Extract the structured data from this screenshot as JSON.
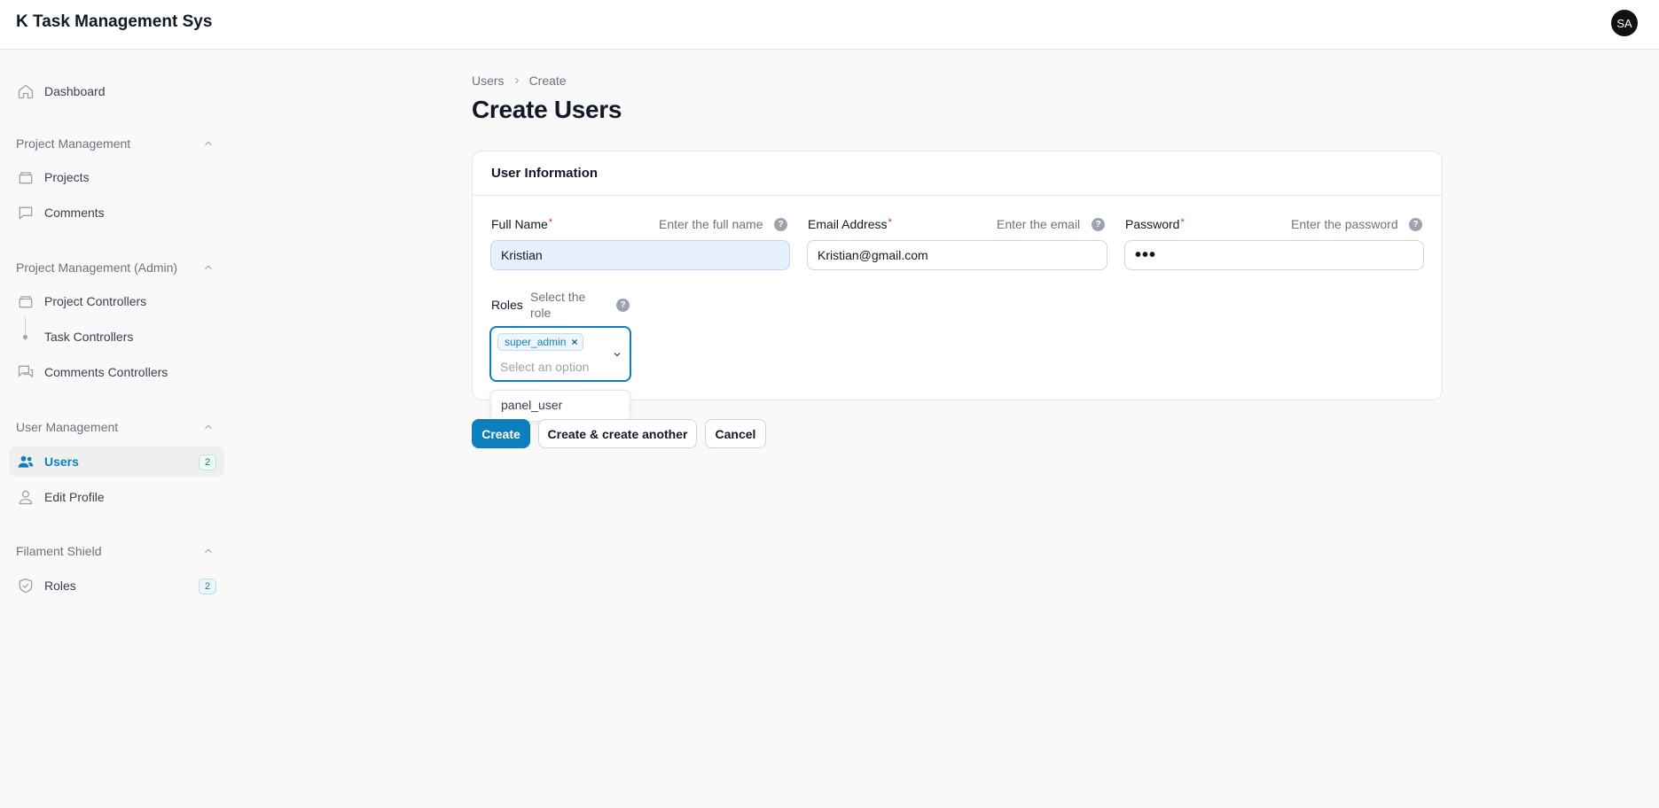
{
  "app": {
    "title": "K Task Management Sys",
    "user_initials": "SA"
  },
  "sidebar": {
    "dashboard": "Dashboard",
    "groups": [
      {
        "label": "Project Management"
      },
      {
        "label": "Project Management (Admin)"
      },
      {
        "label": "User Management"
      },
      {
        "label": "Filament Shield"
      }
    ],
    "items": {
      "projects": "Projects",
      "comments": "Comments",
      "project_controllers": "Project Controllers",
      "task_controllers": "Task Controllers",
      "comments_controllers": "Comments Controllers",
      "users": "Users",
      "users_badge": "2",
      "edit_profile": "Edit Profile",
      "roles": "Roles",
      "roles_badge": "2"
    },
    "active_item": "Users"
  },
  "breadcrumb": {
    "parent": "Users",
    "current": "Create"
  },
  "page": {
    "title": "Create Users"
  },
  "form": {
    "section_title": "User Information",
    "full_name": {
      "label": "Full Name",
      "hint": "Enter the full name",
      "value": "Kristian"
    },
    "email": {
      "label": "Email Address",
      "hint": "Enter the email",
      "value": "Kristian@gmail.com"
    },
    "password": {
      "label": "Password",
      "hint": "Enter the password",
      "value": "•••"
    },
    "roles": {
      "label": "Roles",
      "hint_line1": "Select the",
      "hint_line2": "role",
      "selected": [
        "super_admin"
      ],
      "placeholder": "Select an option",
      "options": [
        "panel_user"
      ]
    },
    "required_mark": "*",
    "help_glyph": "?"
  },
  "actions": {
    "create": "Create",
    "create_another": "Create & create another",
    "cancel": "Cancel"
  },
  "colors": {
    "primary": "#0d7fbe",
    "badge_green": "#0b8a55"
  }
}
